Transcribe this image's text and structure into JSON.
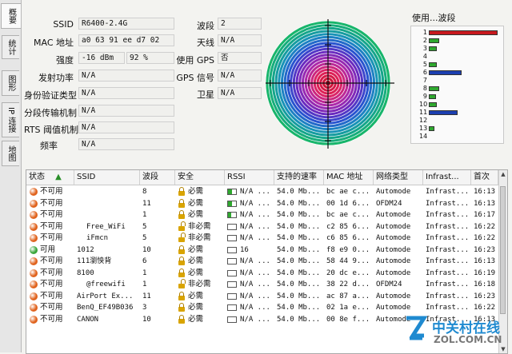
{
  "tabs": [
    {
      "label": "概要",
      "active": true
    },
    {
      "label": "统计",
      "active": false
    },
    {
      "label": "图形",
      "active": false
    },
    {
      "label": "IP 连接",
      "active": false
    },
    {
      "label": "地图",
      "active": false
    }
  ],
  "info": {
    "ssid_label": "SSID",
    "ssid_value": "R6400-2.4G",
    "mac_label": "MAC 地址",
    "mac_value": "a0 63 91 ee d7 02",
    "strength_label": "强度",
    "strength_dbm": "-16 dBm",
    "strength_pct": "92 %",
    "tx_label": "发射功率",
    "tx_value": "N/A",
    "auth_label": "身份验证类型",
    "auth_value": "N/A",
    "frag_label": "分段传输机制",
    "frag_value": "N/A",
    "rts_label": "RTS 阈值机制",
    "rts_value": "N/A",
    "freq_label": "频率",
    "freq_value": "N/A",
    "channel_label": "波段",
    "channel_value": "2",
    "antenna_label": "天线",
    "antenna_value": "N/A",
    "gps_label": "使用 GPS",
    "gps_value": "否",
    "gps_signal_label": "GPS 信号",
    "gps_signal_value": "N/A",
    "satellite_label": "卫星",
    "satellite_value": "N/A"
  },
  "usage": {
    "title": "使用...波段",
    "channels": [
      {
        "ch": "1",
        "value": 1.0,
        "color": "#c8191e"
      },
      {
        "ch": "2",
        "value": 0.15,
        "color": "#2fa82f"
      },
      {
        "ch": "3",
        "value": 0.12,
        "color": "#2fa82f"
      },
      {
        "ch": "4",
        "value": 0,
        "color": "#2fa82f"
      },
      {
        "ch": "5",
        "value": 0.12,
        "color": "#2fa82f"
      },
      {
        "ch": "6",
        "value": 0.48,
        "color": "#1c3fb0"
      },
      {
        "ch": "7",
        "value": 0,
        "color": "#2fa82f"
      },
      {
        "ch": "8",
        "value": 0.15,
        "color": "#2fa82f"
      },
      {
        "ch": "9",
        "value": 0.1,
        "color": "#2fa82f"
      },
      {
        "ch": "10",
        "value": 0.12,
        "color": "#2fa82f"
      },
      {
        "ch": "11",
        "value": 0.42,
        "color": "#1c3fb0"
      },
      {
        "ch": "12",
        "value": 0,
        "color": "#2fa82f"
      },
      {
        "ch": "13",
        "value": 0.08,
        "color": "#2fa82f"
      },
      {
        "ch": "14",
        "value": 0,
        "color": "#2fa82f"
      }
    ]
  },
  "table": {
    "headers": [
      "状态",
      "SSID",
      "波段",
      "安全",
      "RSSI",
      "支持的速率",
      "MAC 地址",
      "网络类型",
      "Infrast...",
      "首次"
    ],
    "sort_icon": "▲",
    "rows": [
      {
        "status": "不可用",
        "dot": "#e0621c",
        "ssid": "",
        "channel": "8",
        "lock": "closed",
        "security": "必需",
        "rssi_fill": 0.5,
        "rssi": "N/A ...",
        "rate": "54.0 Mb...",
        "mac": "bc ae c...",
        "type": "Automode",
        "infra": "Infrast...",
        "first": "16:13"
      },
      {
        "status": "不可用",
        "dot": "#e0621c",
        "ssid": "",
        "channel": "11",
        "lock": "closed",
        "security": "必需",
        "rssi_fill": 0.5,
        "rssi": "N/A ...",
        "rate": "54.0 Mb...",
        "mac": "00 1d 6...",
        "type": "OFDM24",
        "infra": "Infrast...",
        "first": "16:13"
      },
      {
        "status": "不可用",
        "dot": "#e0621c",
        "ssid": "",
        "channel": "1",
        "lock": "closed",
        "security": "必需",
        "rssi_fill": 0.4,
        "rssi": "N/A ...",
        "rate": "54.0 Mb...",
        "mac": "bc ae c...",
        "type": "Automode",
        "infra": "Infrast...",
        "first": "16:17"
      },
      {
        "status": "不可用",
        "dot": "#e0621c",
        "ssid": "Free_WiFi",
        "channel": "5",
        "lock": "open",
        "security": "非必需",
        "rssi_fill": 0,
        "rssi": "N/A ...",
        "rate": "54.0 Mb...",
        "mac": "c2 85 6...",
        "type": "Automode",
        "infra": "Infrast...",
        "first": "16:22"
      },
      {
        "status": "不可用",
        "dot": "#e0621c",
        "ssid": "iFmcn",
        "channel": "5",
        "lock": "open",
        "security": "非必需",
        "rssi_fill": 0,
        "rssi": "N/A ...",
        "rate": "54.0 Mb...",
        "mac": "c6 85 6...",
        "type": "Automode",
        "infra": "Infrast...",
        "first": "16:22"
      },
      {
        "status": "可用",
        "dot": "#3aa63a",
        "ssid": "1012",
        "channel": "10",
        "lock": "closed",
        "security": "必需",
        "rssi_fill": 0,
        "rssi": "16",
        "rate": "54.0 Mb...",
        "mac": "f8 e9 0...",
        "type": "Automode",
        "infra": "Infrast...",
        "first": "16:23"
      },
      {
        "status": "不可用",
        "dot": "#e0621c",
        "ssid": "111瀏怏背",
        "channel": "6",
        "lock": "closed",
        "security": "必需",
        "rssi_fill": 0,
        "rssi": "N/A ...",
        "rate": "54.0 Mb...",
        "mac": "58 44 9...",
        "type": "Automode",
        "infra": "Infrast...",
        "first": "16:13"
      },
      {
        "status": "不可用",
        "dot": "#e0621c",
        "ssid": "8100",
        "channel": "1",
        "lock": "closed",
        "security": "必需",
        "rssi_fill": 0,
        "rssi": "N/A ...",
        "rate": "54.0 Mb...",
        "mac": "20 dc e...",
        "type": "Automode",
        "infra": "Infrast...",
        "first": "16:19"
      },
      {
        "status": "不可用",
        "dot": "#e0621c",
        "ssid": "@freewifi",
        "channel": "1",
        "lock": "open",
        "security": "非必需",
        "rssi_fill": 0,
        "rssi": "N/A ...",
        "rate": "54.0 Mb...",
        "mac": "38 22 d...",
        "type": "OFDM24",
        "infra": "Infrast...",
        "first": "16:18"
      },
      {
        "status": "不可用",
        "dot": "#e0621c",
        "ssid": "AirPort Ex...",
        "channel": "11",
        "lock": "closed",
        "security": "必需",
        "rssi_fill": 0,
        "rssi": "N/A ...",
        "rate": "54.0 Mb...",
        "mac": "ac 87 a...",
        "type": "Automode",
        "infra": "Infrast...",
        "first": "16:23"
      },
      {
        "status": "不可用",
        "dot": "#e0621c",
        "ssid": "BenQ_EF49B036",
        "channel": "3",
        "lock": "closed",
        "security": "必需",
        "rssi_fill": 0,
        "rssi": "N/A ...",
        "rate": "54.0 Mb...",
        "mac": "02 1a e...",
        "type": "Automode",
        "infra": "Infrast...",
        "first": "16:22"
      },
      {
        "status": "不可用",
        "dot": "#e0621c",
        "ssid": "CANON",
        "channel": "10",
        "lock": "closed",
        "security": "必需",
        "rssi_fill": 0,
        "rssi": "N/A ...",
        "rate": "54.0 Mb...",
        "mac": "00 8e f...",
        "type": "Automode",
        "infra": "Infrast...",
        "first": "16:13"
      }
    ]
  },
  "watermark": {
    "brand": "中关村在线",
    "url": "ZOL.COM.CN"
  }
}
